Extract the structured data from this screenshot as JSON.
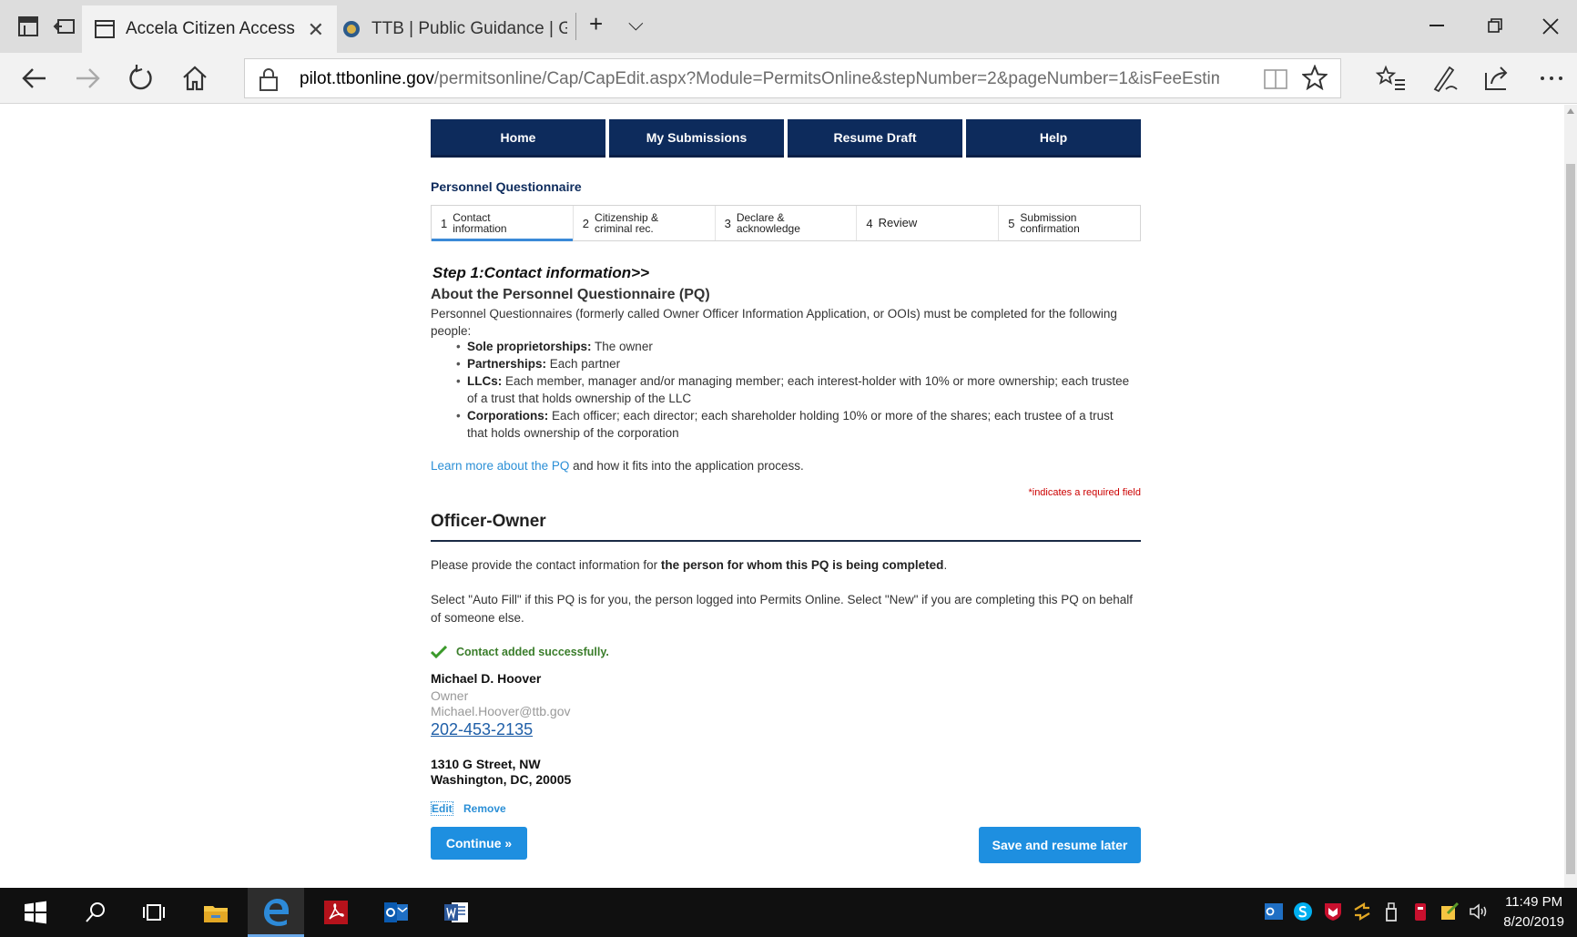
{
  "browser": {
    "tabs": [
      {
        "label": "Accela Citizen Access",
        "active": true
      },
      {
        "label": "TTB | Public Guidance | Guic",
        "active": false
      }
    ],
    "url_domain": "pilot.ttbonline.gov",
    "url_path": "/permitsonline/Cap/CapEdit.aspx?Module=PermitsOnline&stepNumber=2&pageNumber=1&isFeeEstimator=&Tab",
    "new_tab_glyph": "+",
    "tab_list_glyph": "⌵",
    "close_glyph": "✕"
  },
  "menu": [
    {
      "label": "Home"
    },
    {
      "label": "My Submissions"
    },
    {
      "label": "Resume Draft"
    },
    {
      "label": "Help"
    }
  ],
  "page_title": "Personnel Questionnaire",
  "steps": [
    {
      "number": "1",
      "label": "Contact information",
      "active": true
    },
    {
      "number": "2",
      "label": "Citizenship & criminal rec.",
      "active": false
    },
    {
      "number": "3",
      "label": "Declare & acknowledge",
      "active": false
    },
    {
      "number": "4",
      "label": "Review",
      "active": false
    },
    {
      "number": "5",
      "label": "Submission confirmation",
      "active": false
    }
  ],
  "step_heading": "Step 1:Contact information>>",
  "about": {
    "title": "About the Personnel Questionnaire (PQ)",
    "intro": "Personnel Questionnaires (formerly called Owner Officer Information Application, or OOIs) must be completed for the following people:",
    "bullets": [
      {
        "term": "Sole proprietorships:",
        "text": " The owner"
      },
      {
        "term": "Partnerships:",
        "text": " Each partner"
      },
      {
        "term": "LLCs:",
        "text": " Each member, manager and/or managing member; each interest-holder with 10% or more ownership; each trustee of a trust that holds ownership of the LLC"
      },
      {
        "term": "Corporations:",
        "text": " Each officer; each director; each shareholder holding 10% or more of the shares; each trustee of a trust that holds ownership of the corporation"
      }
    ],
    "learn_link": "Learn more about the PQ",
    "learn_rest": " and how it fits into the application process."
  },
  "required_note": {
    "star": "*",
    "text": "indicates a required field"
  },
  "section": {
    "title": "Officer-Owner",
    "p1_prefix": "Please provide the contact information for ",
    "p1_bold": "the person for whom this PQ is being completed",
    "p1_suffix": ".",
    "p2": "Select \"Auto Fill\" if this PQ is for you, the person logged into Permits Online.  Select \"New\" if you are completing this PQ on behalf of someone else."
  },
  "success_message": "Contact added successfully.",
  "contact": {
    "name": "Michael D. Hoover",
    "role": "Owner",
    "email": "Michael.Hoover@ttb.gov",
    "phone": "202-453-2135",
    "address_line1": "1310 G Street, NW",
    "address_line2": "Washington, DC, 20005"
  },
  "actions": {
    "edit": "Edit",
    "remove": "Remove"
  },
  "buttons": {
    "continue": "Continue »",
    "save": "Save and resume later"
  },
  "taskbar": {
    "time": "11:49 PM",
    "date": "8/20/2019"
  },
  "colors": {
    "nav_navy": "#0d2b5c",
    "accent_blue": "#1e8fe0",
    "success_green": "#3a7d2a",
    "link_blue": "#2b8fd6"
  }
}
